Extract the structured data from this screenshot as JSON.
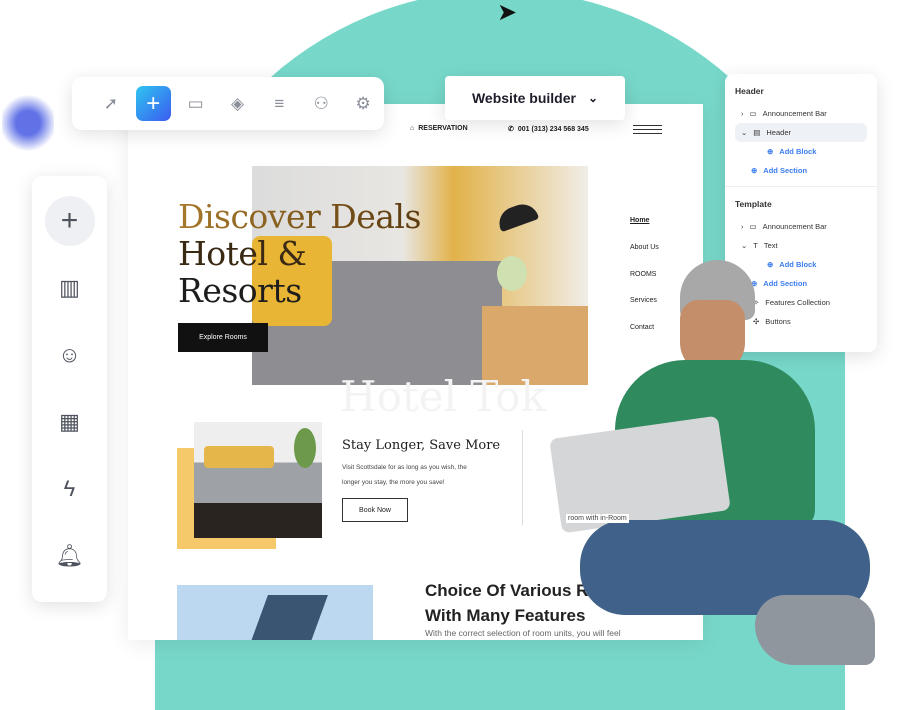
{
  "toolbar": {
    "icons": [
      "cursor-icon",
      "plus-icon",
      "folder-icon",
      "component-icon",
      "database-icon",
      "users-icon",
      "gear-icon"
    ]
  },
  "builder": {
    "label": "Website builder"
  },
  "sidebar": {
    "icons": [
      "plus-icon",
      "chart-icon",
      "user-icon",
      "calendar-icon",
      "lightning-icon",
      "bell-icon"
    ]
  },
  "panel": {
    "header_title": "Header",
    "header_items": [
      "Announcement Bar",
      "Header"
    ],
    "add_block": "Add Block",
    "add_section": "Add Section",
    "template_title": "Template",
    "template_items": [
      "Announcement Bar",
      "Text",
      "Features Collection",
      "Buttons"
    ]
  },
  "site": {
    "reservation": "RESERVATION",
    "phone": "001 (313) 234 568 345",
    "hero_line1": "Discover Deals",
    "hero_line2": "Hotel &",
    "hero_line3": "Resorts",
    "cta": "Explore Rooms",
    "nav": [
      "Home",
      "About Us",
      "ROOMS",
      "Services",
      "Contact"
    ],
    "watermark": "Hotel Tok",
    "s2_title": "Stay Longer, Save More",
    "s2_text1": "Visit Scottsdale for as long as you wish, the",
    "s2_text2": "longer you stay, the more you save!",
    "s2_button": "Book Now",
    "s2b_text": "room with in-Room",
    "s3_title1": "Choice Of Various Ro",
    "s3_title2": "With Many Features",
    "s3_text": "With the correct selection of room units, you will feel"
  },
  "colors": {
    "teal": "#77d8ca",
    "accent": "#3b7cf0",
    "gold": "#b8892b",
    "yellow": "#f5c96a"
  }
}
